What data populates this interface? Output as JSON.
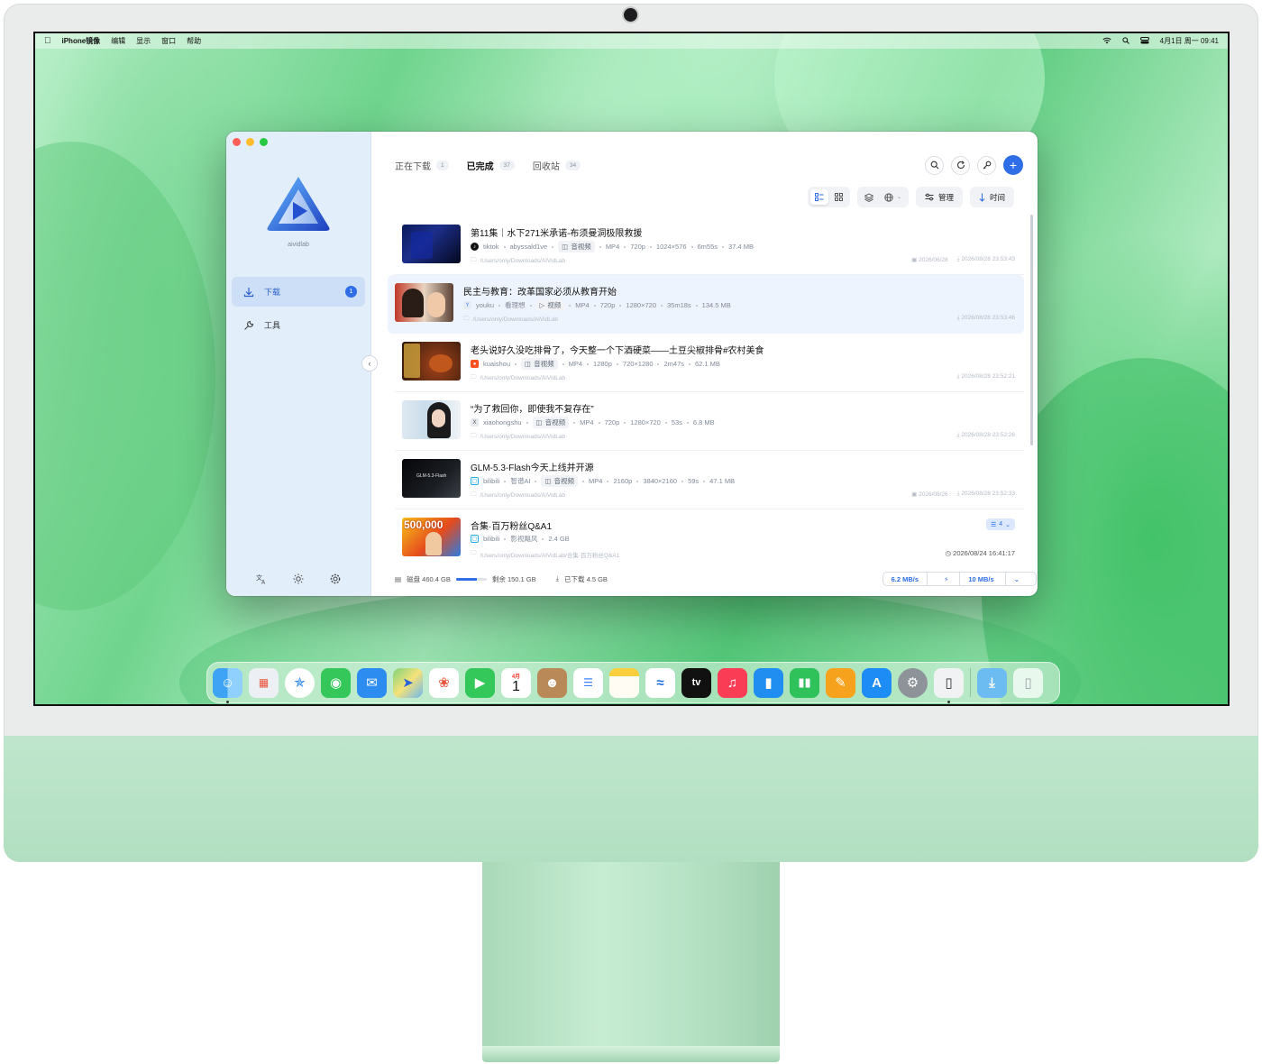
{
  "menubar": {
    "app_name": "iPhone镜像",
    "items": [
      "编辑",
      "显示",
      "窗口",
      "帮助"
    ],
    "datetime": "4月1日 周一  09:41"
  },
  "app": {
    "brand": "aividlab",
    "nav": [
      {
        "label": "下载",
        "badge": "1",
        "active": true,
        "icon": "download-icon"
      },
      {
        "label": "工具",
        "badge": "",
        "active": false,
        "icon": "wrench-icon"
      }
    ],
    "tabs": [
      {
        "label": "正在下载",
        "count": "1",
        "active": false
      },
      {
        "label": "已完成",
        "count": "37",
        "active": true
      },
      {
        "label": "回收站",
        "count": "34",
        "active": false
      }
    ],
    "toolbar": {
      "manage_label": "管理",
      "sort_label": "时间"
    },
    "rows": [
      {
        "title": "第11集｜水下271米承诺-布须曼洞极限救援",
        "platform": "tiktok",
        "author": "abyssald1ve",
        "kind": "音视频",
        "meta": [
          "MP4",
          "720p",
          "1024×576",
          "6m55s",
          "37.4 MB"
        ],
        "path": "/Users/only/Downloads/AIVidLab",
        "published": "2026/06/28",
        "downloaded": "2026/08/28 23:53:43"
      },
      {
        "title": "民主与教育：改革国家必须从教育开始",
        "platform": "youku",
        "author": "看理想",
        "kind": "视频",
        "meta": [
          "MP4",
          "720p",
          "1280×720",
          "35m18s",
          "134.5 MB"
        ],
        "path": "/Users/only/Downloads/AIVidLab",
        "published": "",
        "downloaded": "2026/08/28 23:53:46"
      },
      {
        "title": "老头说好久没吃排骨了，今天整一个下酒硬菜——土豆尖椒排骨#农村美食",
        "platform": "kuaishou",
        "author": "",
        "kind": "音视频",
        "meta": [
          "MP4",
          "1280p",
          "720×1280",
          "2m47s",
          "62.1 MB"
        ],
        "path": "/Users/only/Downloads/AIVidLab",
        "published": "",
        "downloaded": "2026/08/28 23:52:21"
      },
      {
        "title": "“为了救回你，即使我不复存在”",
        "platform": "xiaohongshu",
        "author": "",
        "kind": "音视频",
        "meta": [
          "MP4",
          "720p",
          "1280×720",
          "53s",
          "6.8 MB"
        ],
        "path": "/Users/only/Downloads/AIVidLab",
        "published": "",
        "downloaded": "2026/08/28 23:52:26"
      },
      {
        "title": "GLM-5.3-Flash今天上线并开源",
        "platform": "bilibili",
        "author": "智谱AI",
        "kind": "音视频",
        "meta": [
          "MP4",
          "2160p",
          "3840×2160",
          "59s",
          "47.1 MB"
        ],
        "path": "/Users/only/Downloads/AIVidLab",
        "published": "2026/08/26",
        "downloaded": "2026/08/28 23:52:33",
        "thumb_text": "GLM-5.3-Flash"
      },
      {
        "title": "合集·百万粉丝Q&A1",
        "platform": "bilibili",
        "author": "影视飓风",
        "kind": "",
        "meta": [
          "2.4 GB"
        ],
        "path": "/Users/only/Downloads/AIVidLab/合集·百万粉丝Q&A1",
        "published": "",
        "downloaded": "2026/08/24 16:41:17",
        "group_count": "4",
        "thumb_text": "500,000"
      }
    ],
    "status": {
      "disk_label": "磁盘 460.4 GB",
      "disk_used_fraction": 0.67,
      "remaining": "剩余 150.1 GB",
      "downloaded": "已下载 4.5 GB",
      "speed_down": "6.2 MB/s",
      "speed_limit": "10 MB/s"
    }
  },
  "dock": {
    "calendar_month": "4月",
    "calendar_day": "1",
    "tv_label": "tv"
  },
  "colors": {
    "accent": "#2f6ee6",
    "sidebar_bg": "#e3eefb",
    "wallpaper": "#6fd48d"
  }
}
